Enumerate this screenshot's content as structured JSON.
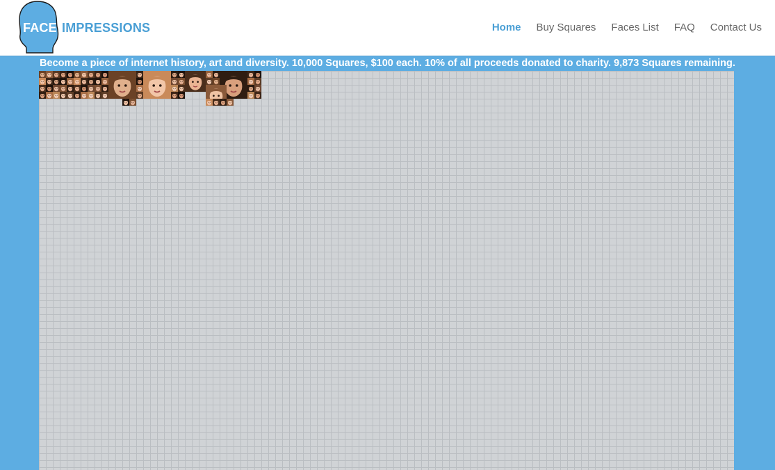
{
  "header": {
    "logo": {
      "word1": "FACE",
      "word2": "IMPRESSIONS"
    },
    "nav": [
      {
        "label": "Home",
        "active": true
      },
      {
        "label": "Buy Squares",
        "active": false
      },
      {
        "label": "Faces List",
        "active": false
      },
      {
        "label": "FAQ",
        "active": false
      },
      {
        "label": "Contact Us",
        "active": false
      }
    ]
  },
  "banner": {
    "text": "Become a piece of internet history, art and diversity. 10,000 Squares, $100 each. 10% of all proceeds donated to charity. 9,873 Squares remaining."
  },
  "colors": {
    "accent": "#4a9fd5",
    "page_background": "#5dade2",
    "grid_square": "#d0d3d6"
  },
  "grid": {
    "total_squares": 10000,
    "faces": [
      {
        "skin": "#e0b08c",
        "hair": "#6b4226"
      },
      {
        "skin": "#f2c6a8",
        "hair": "#c98a5a"
      },
      {
        "skin": "#eab493",
        "hair": "#4a2e1c"
      },
      {
        "skin": "#d9a07d",
        "hair": "#2f1d12"
      },
      {
        "skin": "#f0c4a4",
        "hair": "#8a5a3a"
      },
      {
        "skin": "#e8b89a",
        "hair": "#3b2618"
      },
      {
        "skin": "#c98e6c",
        "hair": "#1e120b"
      },
      {
        "skin": "#f1cbb3",
        "hair": "#a66c44"
      },
      {
        "skin": "#e3ab89",
        "hair": "#5a3a24"
      },
      {
        "skin": "#d8a584",
        "hair": "#2a1a10"
      },
      {
        "skin": "#e9bfa3",
        "hair": "#6e4630"
      },
      {
        "skin": "#f3d0b8",
        "hair": "#b98556"
      },
      {
        "skin": "#dba27f",
        "hair": "#3d2416"
      },
      {
        "skin": "#efc3a5",
        "hair": "#20130c"
      },
      {
        "skin": "#e2b295",
        "hair": "#7a4e30"
      },
      {
        "skin": "#f0c9ae",
        "hair": "#4b2f1d"
      },
      {
        "skin": "#d5997a",
        "hair": "#1a100a"
      },
      {
        "skin": "#ecbc9e",
        "hair": "#94603c"
      },
      {
        "skin": "#e6b597",
        "hair": "#2e1c11"
      },
      {
        "skin": "#f2cdb5",
        "hair": "#5e3d27"
      }
    ]
  }
}
